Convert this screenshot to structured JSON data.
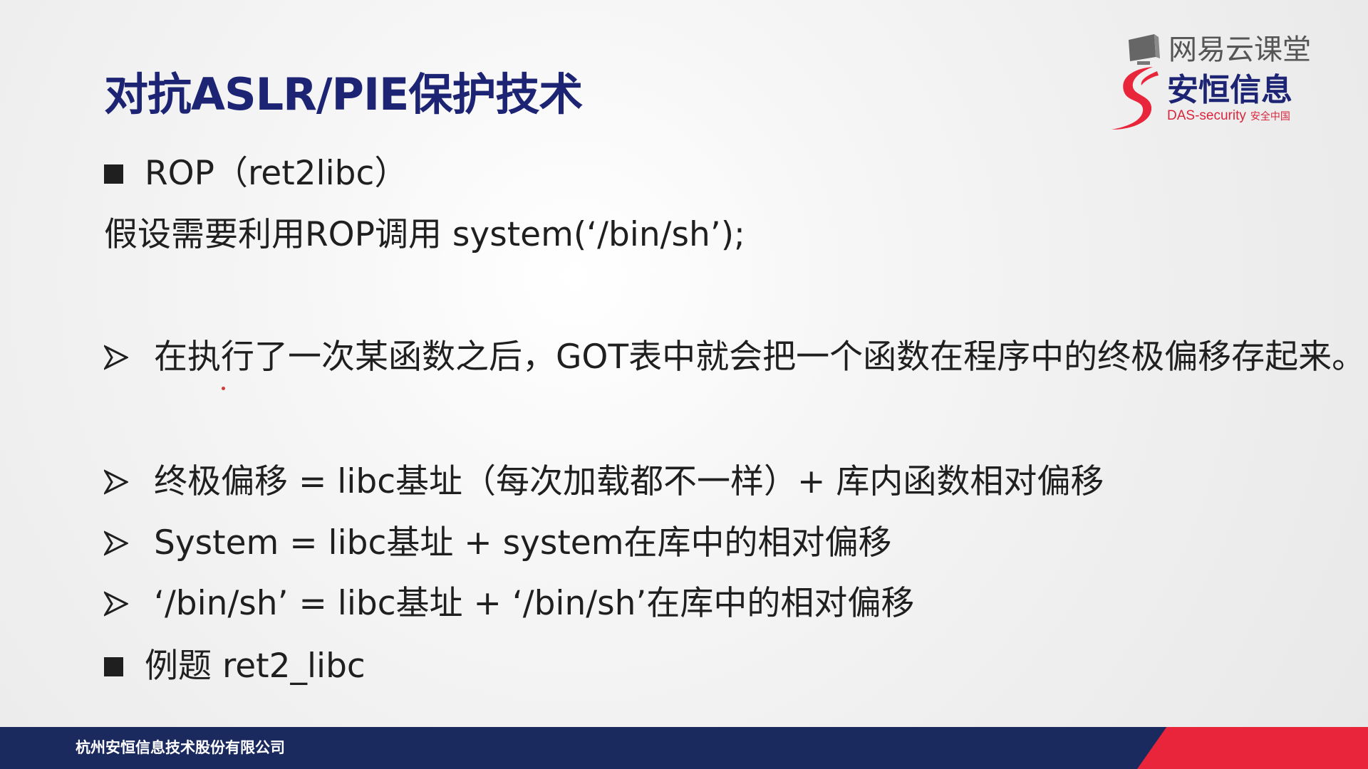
{
  "slide": {
    "title": "对抗ASLR/PIE保护技术",
    "lines": [
      {
        "bullet": "square-bullet",
        "text": "ROP（ret2libc）"
      },
      {
        "bullet": "",
        "text": "假设需要利用ROP调用 system(‘/bin/sh’);"
      },
      {
        "bullet": "arrow-bullet",
        "text": "在执行了一次某函数之后，GOT表中就会把一个函数在程序中的终极偏移存起来。"
      },
      {
        "bullet": "arrow-bullet",
        "text": "终极偏移 = libc基址（每次加载都不一样）+ 库内函数相对偏移"
      },
      {
        "bullet": "arrow-bullet",
        "text": "System = libc基址 + system在库中的相对偏移"
      },
      {
        "bullet": "arrow-bullet",
        "text": "‘/bin/sh’ = libc基址 + ‘/bin/sh’在库中的相对偏移"
      },
      {
        "bullet": "square-bullet",
        "text": "例题 ret2_libc"
      }
    ]
  },
  "brand": {
    "platform": "网易云课堂",
    "company_short": "安恒信息",
    "company_en": "DAS-security",
    "company_tagline": "安全中国",
    "platform_icon": "monitor-icon",
    "company_icon": "das-s-logo-icon"
  },
  "footer": {
    "company_name": "杭州安恒信息技术股份有限公司"
  },
  "colors": {
    "title": "#1c2473",
    "text": "#1f1f1f",
    "footer_navy": "#1b2a5e",
    "footer_red": "#e8253a",
    "brand_red": "#d7263d"
  }
}
